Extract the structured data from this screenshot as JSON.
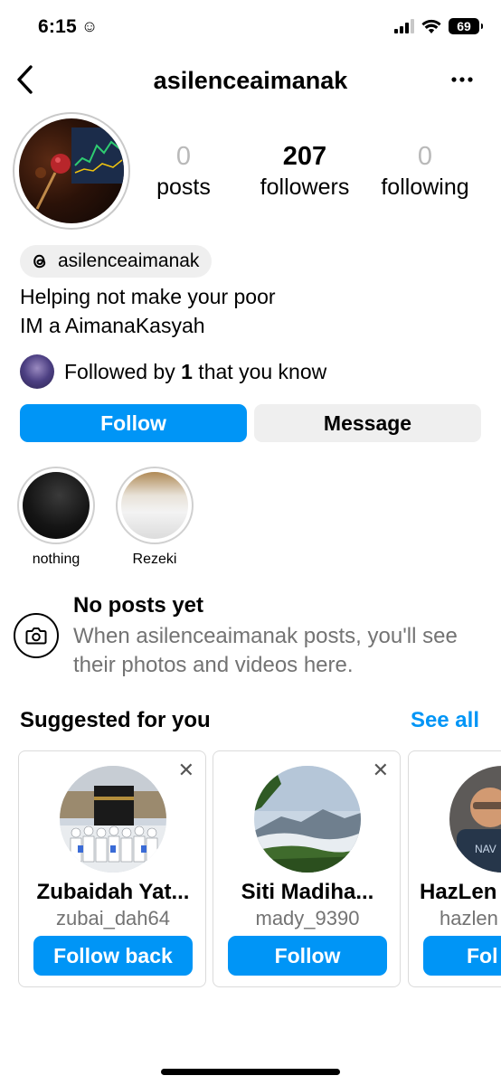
{
  "status_bar": {
    "time": "6:15",
    "smiley_icon": "smiley-icon",
    "battery": "69"
  },
  "header": {
    "title": "asilenceaimanak",
    "back_icon": "chevron-left-icon",
    "more_icon": "more-horizontal-icon"
  },
  "stats": {
    "posts": {
      "value": "0",
      "label": "posts"
    },
    "followers": {
      "value": "207",
      "label": "followers"
    },
    "following": {
      "value": "0",
      "label": "following"
    }
  },
  "threads": {
    "handle": "asilenceaimanak",
    "icon": "threads-icon"
  },
  "bio": {
    "line1": "Helping not make your poor",
    "line2": "IM a AimanaKasyah"
  },
  "followed_by": {
    "prefix": "Followed by ",
    "count": "1",
    "suffix": " that you know"
  },
  "actions": {
    "follow": "Follow",
    "message": "Message"
  },
  "highlights": [
    {
      "label": "nothing"
    },
    {
      "label": "Rezeki"
    }
  ],
  "no_posts": {
    "title": "No posts yet",
    "text": "When asilenceaimanak posts, you'll see their photos and videos here.",
    "icon": "camera-icon"
  },
  "suggested": {
    "title": "Suggested for you",
    "see_all": "See all",
    "close_icon": "close-icon",
    "cards": [
      {
        "name": "Zubaidah Yat...",
        "handle": "zubai_dah64",
        "button": "Follow back"
      },
      {
        "name": "Siti Madiha...",
        "handle": "mady_9390",
        "button": "Follow"
      },
      {
        "name": "HazLen",
        "handle": "hazlen",
        "button": "Fol"
      }
    ]
  },
  "colors": {
    "accent": "#0095f6",
    "muted_text": "#737373",
    "button_gray": "#efefef"
  }
}
